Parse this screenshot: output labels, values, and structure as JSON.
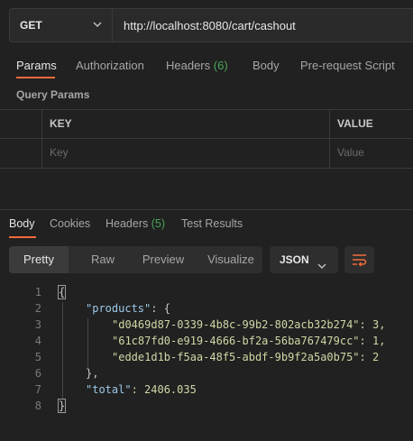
{
  "request": {
    "method": "GET",
    "url": "http://localhost:8080/cart/cashout"
  },
  "request_tabs": [
    {
      "label": "Params",
      "count": ""
    },
    {
      "label": "Authorization",
      "count": ""
    },
    {
      "label": "Headers",
      "count": "(6)"
    },
    {
      "label": "Body",
      "count": ""
    },
    {
      "label": "Pre-request Script",
      "count": ""
    }
  ],
  "query_params": {
    "title": "Query Params",
    "columns": [
      "KEY",
      "VALUE"
    ],
    "placeholders": {
      "key": "Key",
      "value": "Value"
    }
  },
  "response_tabs": [
    {
      "label": "Body",
      "count": ""
    },
    {
      "label": "Cookies",
      "count": ""
    },
    {
      "label": "Headers",
      "count": "(5)"
    },
    {
      "label": "Test Results",
      "count": ""
    }
  ],
  "view_modes": [
    "Pretty",
    "Raw",
    "Preview",
    "Visualize"
  ],
  "format": "JSON",
  "body_lines": [
    {
      "n": "1",
      "text": "{"
    },
    {
      "n": "2",
      "key": "\"products\"",
      "rest": ": {"
    },
    {
      "n": "3",
      "key": "\"d0469d87-0339-4b8c-99b2-802acb32b274\"",
      "rest": ": 3,"
    },
    {
      "n": "4",
      "key": "\"61c87fd0-e919-4666-bf2a-56ba767479cc\"",
      "rest": ": 1,"
    },
    {
      "n": "5",
      "key": "\"edde1d1b-f5aa-48f5-abdf-9b9f2a5a0b75\"",
      "rest": ": 2"
    },
    {
      "n": "6",
      "text": "},"
    },
    {
      "n": "7",
      "key": "\"total\"",
      "rest": ": 2406.035"
    },
    {
      "n": "8",
      "text": "}"
    }
  ],
  "colors": {
    "accent": "#f26b3a",
    "count_green": "#49a35b",
    "background": "#212121"
  }
}
